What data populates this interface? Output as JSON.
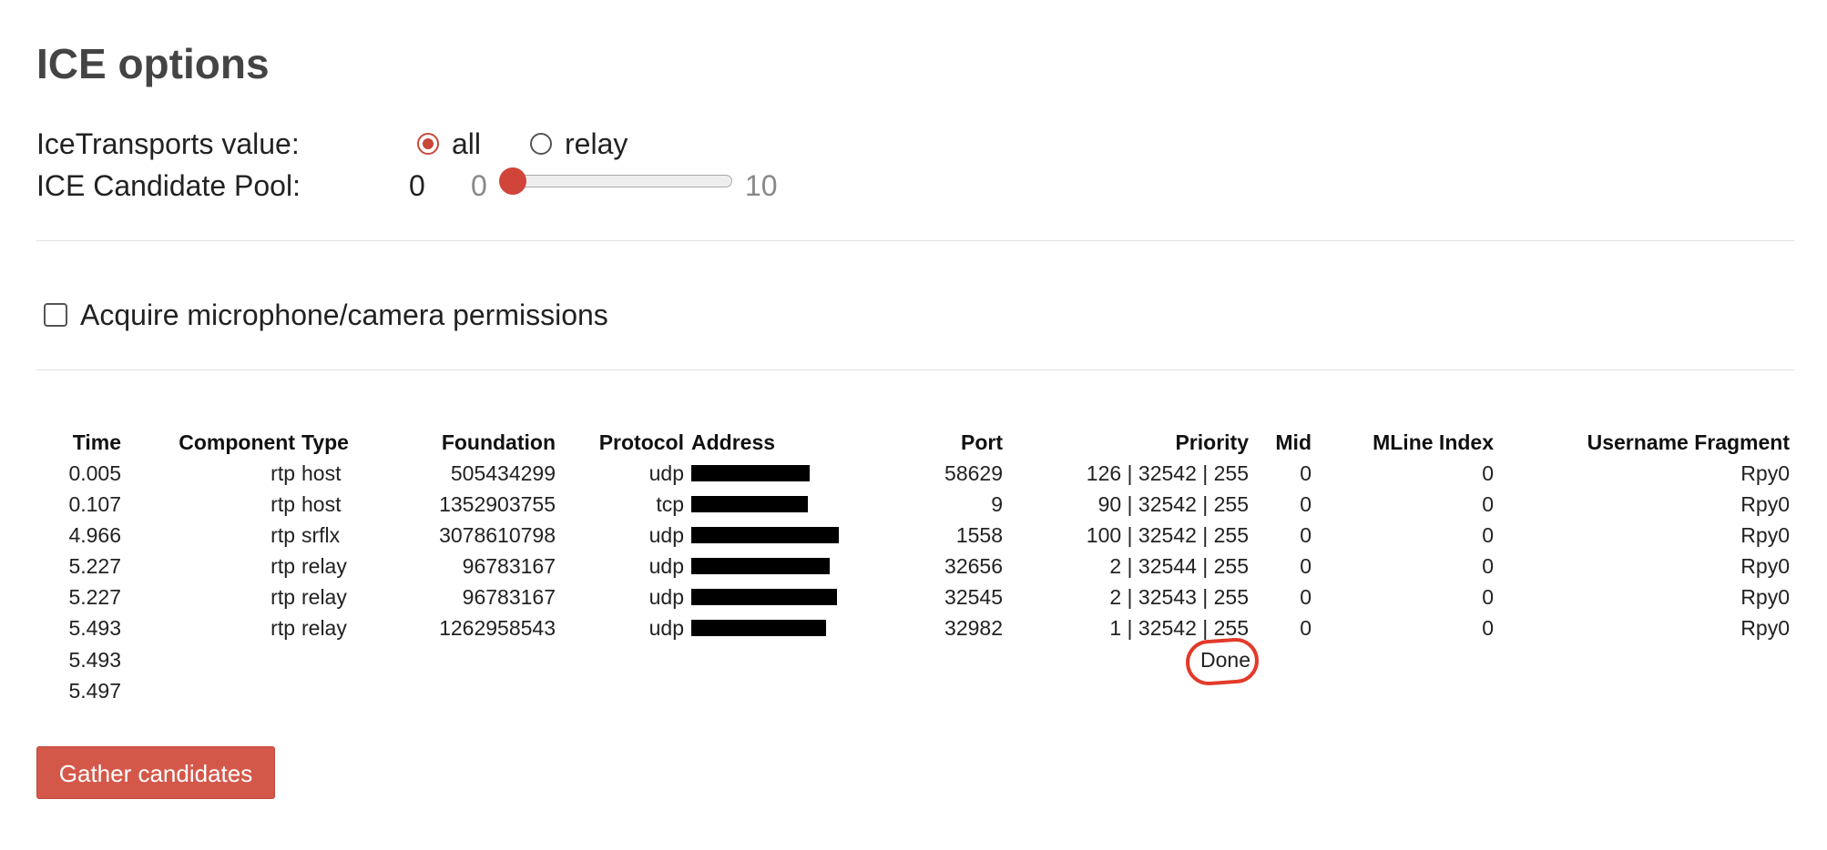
{
  "title": "ICE options",
  "ice_transports": {
    "label": "IceTransports value:",
    "options": [
      {
        "label": "all",
        "checked": true
      },
      {
        "label": "relay",
        "checked": false
      }
    ]
  },
  "pool": {
    "label": "ICE Candidate Pool:",
    "value": "0",
    "min": "0",
    "max": "10",
    "level": 0
  },
  "permissions": {
    "label": "Acquire microphone/camera permissions",
    "checked": false
  },
  "table": {
    "headers": {
      "time": "Time",
      "component": "Component",
      "type": "Type",
      "foundation": "Foundation",
      "protocol": "Protocol",
      "address": "Address",
      "port": "Port",
      "priority": "Priority",
      "mid": "Mid",
      "mline": "MLine Index",
      "ufrag": "Username Fragment"
    },
    "rows": [
      {
        "time": "0.005",
        "component": "rtp",
        "type": "host",
        "foundation": "505434299",
        "protocol": "udp",
        "port": "58629",
        "priority": "126 | 32542 | 255",
        "mid": "0",
        "mline": "0",
        "ufrag": "Rpy0"
      },
      {
        "time": "0.107",
        "component": "rtp",
        "type": "host",
        "foundation": "1352903755",
        "protocol": "tcp",
        "port": "9",
        "priority": "90 | 32542 | 255",
        "mid": "0",
        "mline": "0",
        "ufrag": "Rpy0"
      },
      {
        "time": "4.966",
        "component": "rtp",
        "type": "srflx",
        "foundation": "3078610798",
        "protocol": "udp",
        "port": "1558",
        "priority": "100 | 32542 | 255",
        "mid": "0",
        "mline": "0",
        "ufrag": "Rpy0"
      },
      {
        "time": "5.227",
        "component": "rtp",
        "type": "relay",
        "foundation": "96783167",
        "protocol": "udp",
        "port": "32656",
        "priority": "2 | 32544 | 255",
        "mid": "0",
        "mline": "0",
        "ufrag": "Rpy0"
      },
      {
        "time": "5.227",
        "component": "rtp",
        "type": "relay",
        "foundation": "96783167",
        "protocol": "udp",
        "port": "32545",
        "priority": "2 | 32543 | 255",
        "mid": "0",
        "mline": "0",
        "ufrag": "Rpy0"
      },
      {
        "time": "5.493",
        "component": "rtp",
        "type": "relay",
        "foundation": "1262958543",
        "protocol": "udp",
        "port": "32982",
        "priority": "1 | 32542 | 255",
        "mid": "0",
        "mline": "0",
        "ufrag": "Rpy0"
      }
    ],
    "extra_rows": [
      {
        "time": "5.493",
        "priority": "Done"
      },
      {
        "time": "5.497",
        "priority": ""
      }
    ]
  },
  "gather_button": "Gather candidates",
  "colors": {
    "accent": "#d0443a",
    "button_bg": "#d4584a",
    "annotation_circle": "#e23a2a"
  }
}
